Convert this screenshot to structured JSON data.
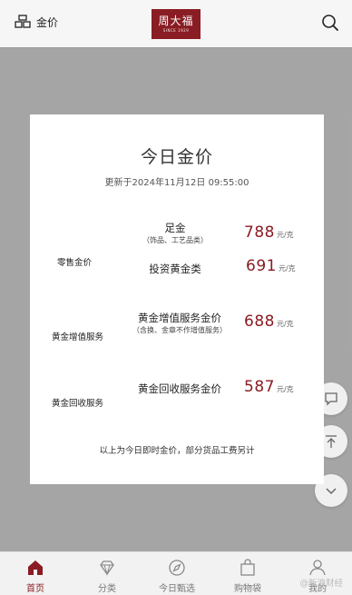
{
  "header": {
    "gold_price_label": "金价",
    "logo_text": "周大福",
    "logo_subtext": "SINCE 1929"
  },
  "modal": {
    "title": "今日金价",
    "updated": "更新于2024年11月12日 09:55:00",
    "sections": [
      {
        "category": "零售金价",
        "items": [
          {
            "name": "足金",
            "note": "（饰品、工艺品类）",
            "price": "788",
            "unit": "元/克"
          },
          {
            "name": "投资黄金类",
            "price": "691",
            "unit": "元/克"
          }
        ]
      },
      {
        "category": "黄金增值服务",
        "items": [
          {
            "name": "黄金增值服务金价",
            "note": "（含换、金章不作增值服务）",
            "price": "688",
            "unit": "元/克"
          }
        ]
      },
      {
        "category": "黄金回收服务",
        "items": [
          {
            "name": "黄金回收服务金价",
            "price": "587",
            "unit": "元/克"
          }
        ]
      }
    ],
    "footnote": "以上为今日即时金价，部分货品工费另计"
  },
  "bottom_nav": [
    {
      "label": "首页",
      "icon": "home-icon",
      "active": true
    },
    {
      "label": "分类",
      "icon": "diamond-icon",
      "active": false
    },
    {
      "label": "今日甄选",
      "icon": "compass-icon",
      "active": false
    },
    {
      "label": "购物袋",
      "icon": "bag-icon",
      "active": false
    },
    {
      "label": "我的",
      "icon": "user-icon",
      "active": false
    }
  ],
  "watermark": "@新浪财经",
  "colors": {
    "brand": "#8a1c23",
    "overlay": "rgba(0,0,0,0.32)"
  }
}
